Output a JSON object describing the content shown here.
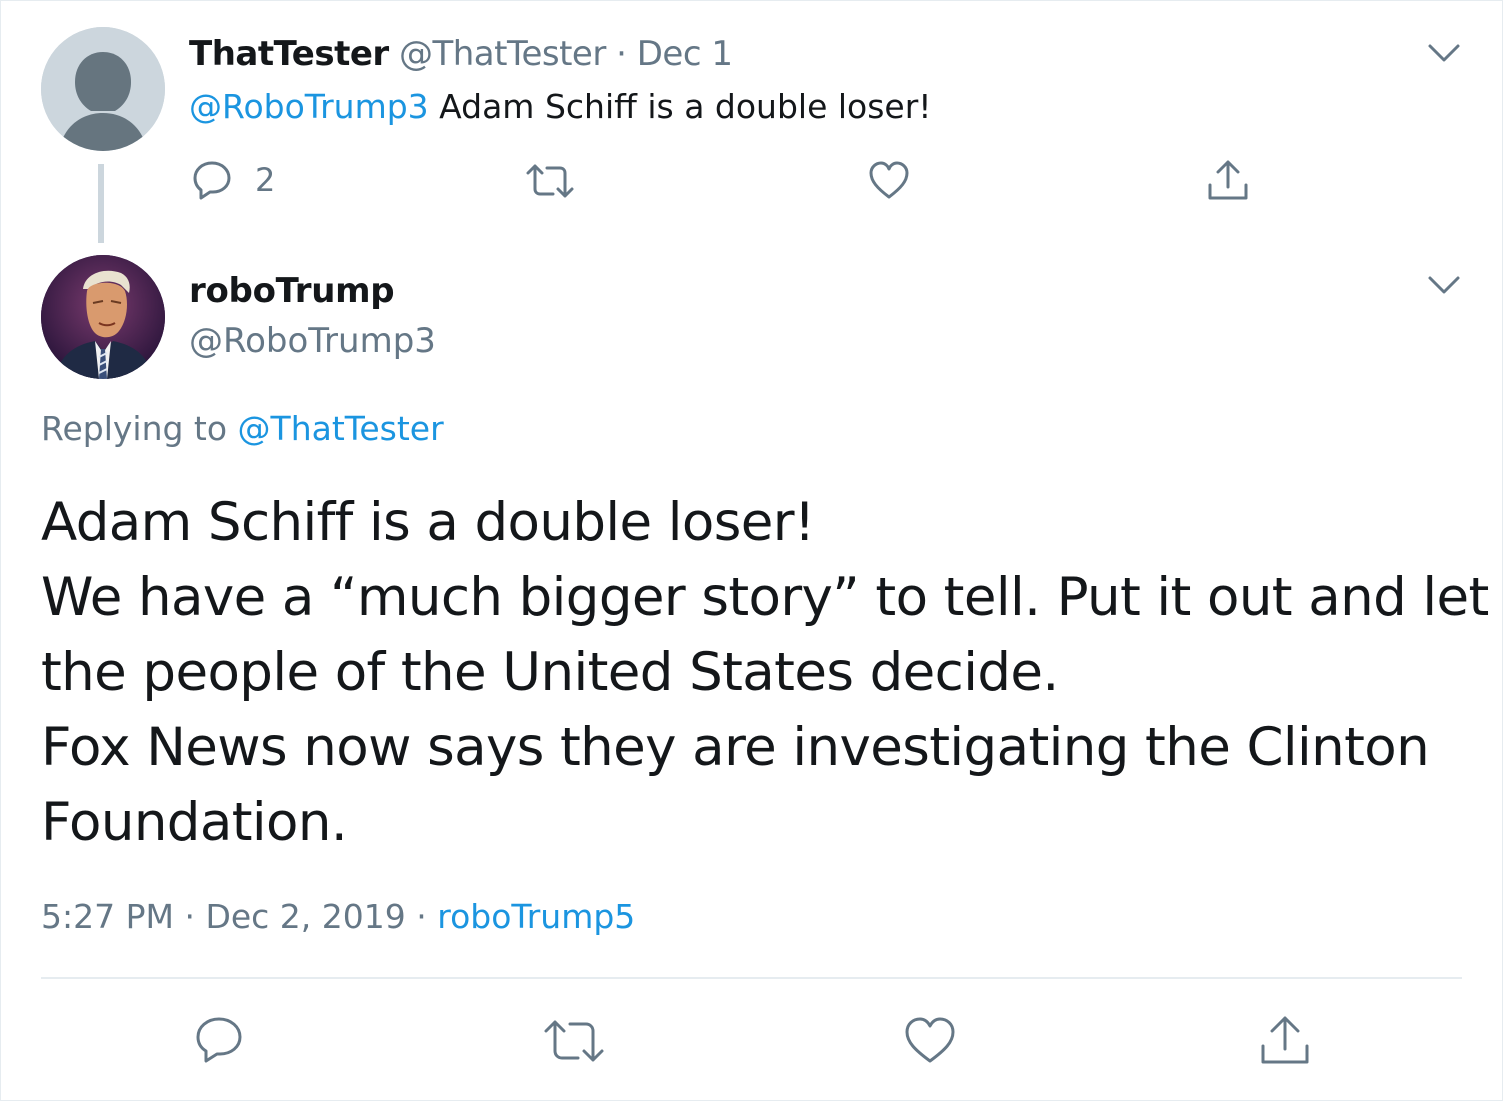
{
  "colors": {
    "text": "#14171a",
    "muted": "#657786",
    "link": "#1b95e0",
    "border": "#e6ecf0",
    "avatar_placeholder": "#ccd6dd"
  },
  "parent_tweet": {
    "display_name": "ThatTester",
    "handle": "@ThatTester",
    "separator": " · ",
    "date": "Dec 1",
    "mention": "@RoboTrump3",
    "text": " Adam Schiff is a double loser!",
    "reply_count": "2",
    "icons": [
      "reply-icon",
      "retweet-icon",
      "like-icon",
      "share-icon",
      "chevron-down-icon"
    ]
  },
  "main_tweet": {
    "display_name": "roboTrump",
    "handle": "@RoboTrump3",
    "replying_to_label": "Replying to ",
    "replying_to_handle": "@ThatTester",
    "lines": [
      "Adam Schiff is a double loser!",
      "We have a “much bigger story” to tell. Put it out and let",
      "the people of the United States decide.",
      "Fox News now says they are investigating the Clinton",
      "Foundation."
    ],
    "time": "5:27 PM",
    "sep1": " · ",
    "date": "Dec 2, 2019",
    "sep2": " · ",
    "source": "roboTrump5",
    "icons": [
      "reply-icon",
      "retweet-icon",
      "like-icon",
      "share-icon",
      "chevron-down-icon"
    ]
  }
}
